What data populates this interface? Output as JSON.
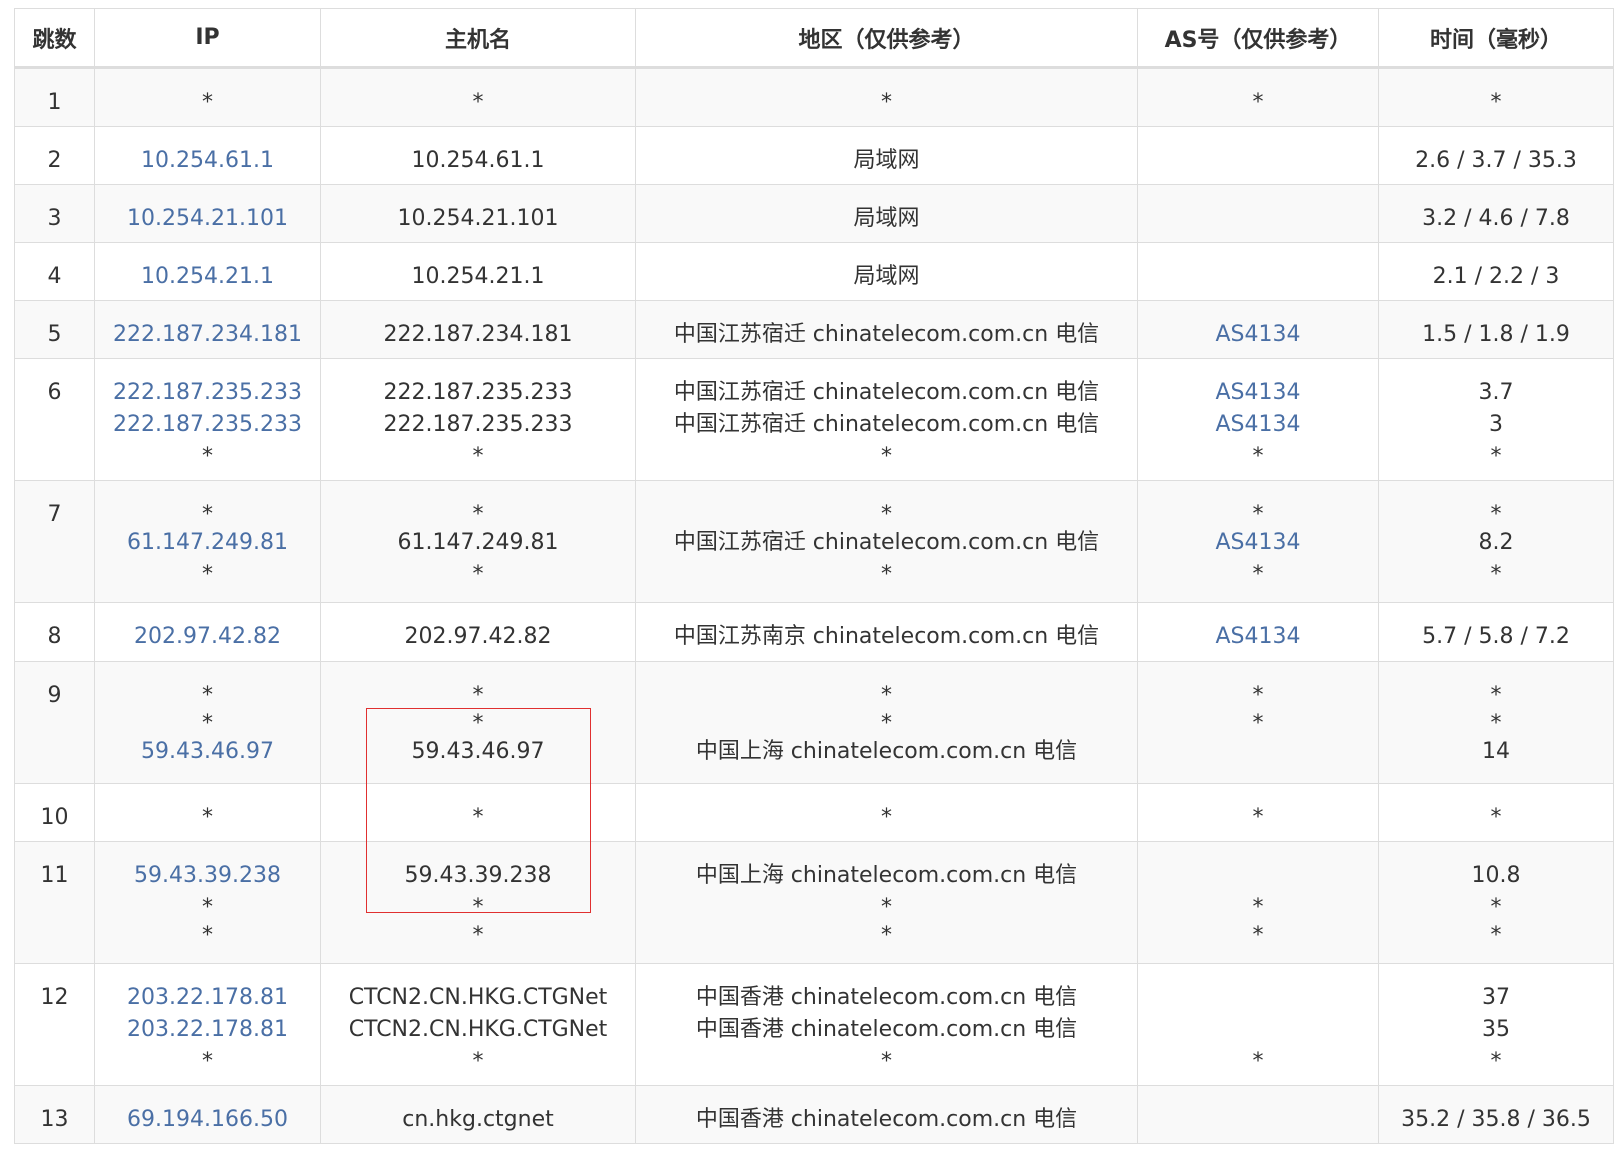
{
  "headers": [
    "跳数",
    "IP",
    "主机名",
    "地区（仅供参考）",
    "AS号（仅供参考）",
    "时间（毫秒）"
  ],
  "rows": [
    {
      "hop": "1",
      "ip": [
        "*"
      ],
      "host": [
        "*"
      ],
      "region": [
        "*"
      ],
      "asn": [
        "*"
      ],
      "time": [
        "*"
      ],
      "height": 59
    },
    {
      "hop": "2",
      "ip": [
        "10.254.61.1"
      ],
      "host": [
        "10.254.61.1"
      ],
      "region": [
        "局域网"
      ],
      "asn": [
        ""
      ],
      "time": [
        "2.6 / 3.7 / 35.3"
      ],
      "height": 58
    },
    {
      "hop": "3",
      "ip": [
        "10.254.21.101"
      ],
      "host": [
        "10.254.21.101"
      ],
      "region": [
        "局域网"
      ],
      "asn": [
        ""
      ],
      "time": [
        "3.2 / 4.6 / 7.8"
      ],
      "height": 58
    },
    {
      "hop": "4",
      "ip": [
        "10.254.21.1"
      ],
      "host": [
        "10.254.21.1"
      ],
      "region": [
        "局域网"
      ],
      "asn": [
        ""
      ],
      "time": [
        "2.1 / 2.2 / 3"
      ],
      "height": 58
    },
    {
      "hop": "5",
      "ip": [
        "222.187.234.181"
      ],
      "host": [
        "222.187.234.181"
      ],
      "region": [
        "中国江苏宿迁 chinatelecom.com.cn 电信"
      ],
      "asn": [
        "AS4134"
      ],
      "time": [
        "1.5 / 1.8 / 1.9"
      ],
      "height": 58
    },
    {
      "hop": "6",
      "ip": [
        "222.187.235.233",
        "222.187.235.233",
        "*"
      ],
      "host": [
        "222.187.235.233",
        "222.187.235.233",
        "*"
      ],
      "region": [
        "中国江苏宿迁 chinatelecom.com.cn 电信",
        "中国江苏宿迁 chinatelecom.com.cn 电信",
        "*"
      ],
      "asn": [
        "AS4134",
        "AS4134",
        "*"
      ],
      "time": [
        "3.7",
        "3",
        "*"
      ],
      "height": 122
    },
    {
      "hop": "7",
      "ip": [
        "*",
        "61.147.249.81",
        "*"
      ],
      "host": [
        "*",
        "61.147.249.81",
        "*"
      ],
      "region": [
        "*",
        "中国江苏宿迁 chinatelecom.com.cn 电信",
        "*"
      ],
      "asn": [
        "*",
        "AS4134",
        "*"
      ],
      "time": [
        "*",
        "8.2",
        "*"
      ],
      "height": 122
    },
    {
      "hop": "8",
      "ip": [
        "202.97.42.82"
      ],
      "host": [
        "202.97.42.82"
      ],
      "region": [
        "中国江苏南京 chinatelecom.com.cn 电信"
      ],
      "asn": [
        "AS4134"
      ],
      "time": [
        "5.7 / 5.8 / 7.2"
      ],
      "height": 59
    },
    {
      "hop": "9",
      "ip": [
        "*",
        "*",
        "59.43.46.97"
      ],
      "host": [
        "*",
        "*",
        "59.43.46.97"
      ],
      "region": [
        "*",
        "*",
        "中国上海 chinatelecom.com.cn 电信"
      ],
      "asn": [
        "*",
        "*",
        ""
      ],
      "time": [
        "*",
        "*",
        "14"
      ],
      "height": 122
    },
    {
      "hop": "10",
      "ip": [
        "*"
      ],
      "host": [
        "*"
      ],
      "region": [
        "*"
      ],
      "asn": [
        "*"
      ],
      "time": [
        "*"
      ],
      "height": 58
    },
    {
      "hop": "11",
      "ip": [
        "59.43.39.238",
        "*",
        "*"
      ],
      "host": [
        "59.43.39.238",
        "*",
        "*"
      ],
      "region": [
        "中国上海 chinatelecom.com.cn 电信",
        "*",
        "*"
      ],
      "asn": [
        "",
        "*",
        "*"
      ],
      "time": [
        "10.8",
        "*",
        "*"
      ],
      "height": 122
    },
    {
      "hop": "12",
      "ip": [
        "203.22.178.81",
        "203.22.178.81",
        "*"
      ],
      "host": [
        "CTCN2.CN.HKG.CTGNet",
        "CTCN2.CN.HKG.CTGNet",
        "*"
      ],
      "region": [
        "中国香港 chinatelecom.com.cn 电信",
        "中国香港 chinatelecom.com.cn 电信",
        "*"
      ],
      "asn": [
        "",
        "",
        "*"
      ],
      "time": [
        "37",
        "35",
        "*"
      ],
      "height": 122
    },
    {
      "hop": "13",
      "ip": [
        "69.194.166.50"
      ],
      "host": [
        "cn.hkg.ctgnet"
      ],
      "region": [
        "中国香港 chinatelecom.com.cn 电信"
      ],
      "asn": [
        ""
      ],
      "time": [
        "35.2 / 35.8 / 36.5"
      ],
      "height": 58
    }
  ],
  "colors": {
    "link": "#4a6fa5",
    "text": "#333333",
    "highlight": "#e03030",
    "border": "#dddddd"
  }
}
